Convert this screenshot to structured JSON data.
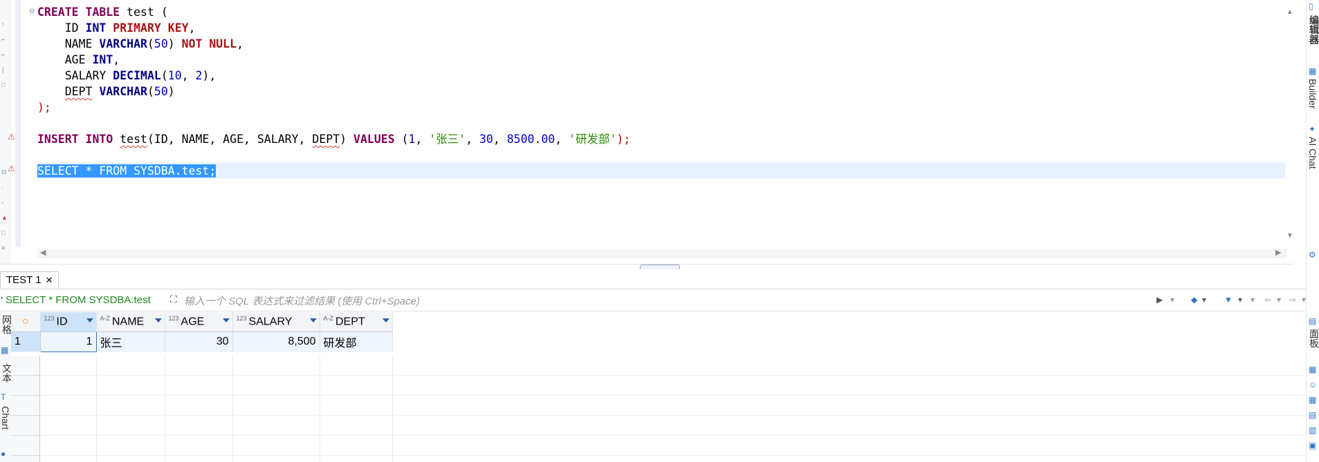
{
  "editor": {
    "lines": [
      {
        "parts": [
          {
            "t": "CREATE",
            "c": "kw-dark"
          },
          {
            "t": " "
          },
          {
            "t": "TABLE",
            "c": "kw-dark"
          },
          {
            "t": " test ("
          }
        ]
      },
      {
        "parts": [
          {
            "t": "    ID "
          },
          {
            "t": "INT",
            "c": "kw-navy"
          },
          {
            "t": " "
          },
          {
            "t": "PRIMARY KEY",
            "c": "kw-red"
          },
          {
            "t": ","
          }
        ]
      },
      {
        "parts": [
          {
            "t": "    NAME "
          },
          {
            "t": "VARCHAR",
            "c": "kw-navy"
          },
          {
            "t": "("
          },
          {
            "t": "50",
            "c": "num"
          },
          {
            "t": ") "
          },
          {
            "t": "NOT NULL",
            "c": "kw-red"
          },
          {
            "t": ","
          }
        ]
      },
      {
        "parts": [
          {
            "t": "    AGE "
          },
          {
            "t": "INT",
            "c": "kw-navy"
          },
          {
            "t": ","
          }
        ]
      },
      {
        "parts": [
          {
            "t": "    SALARY "
          },
          {
            "t": "DECIMAL",
            "c": "kw-navy"
          },
          {
            "t": "("
          },
          {
            "t": "10",
            "c": "num"
          },
          {
            "t": ", "
          },
          {
            "t": "2",
            "c": "num"
          },
          {
            "t": "),"
          }
        ]
      },
      {
        "parts": [
          {
            "t": "    "
          },
          {
            "t": "DEPT",
            "c": "squiggle"
          },
          {
            "t": " "
          },
          {
            "t": "VARCHAR",
            "c": "kw-navy"
          },
          {
            "t": "("
          },
          {
            "t": "50",
            "c": "num"
          },
          {
            "t": ")"
          }
        ]
      },
      {
        "parts": [
          {
            "t": ");",
            "c": "punct-red"
          }
        ]
      },
      {
        "parts": [
          {
            "t": ""
          }
        ]
      },
      {
        "parts": [
          {
            "t": "INSERT",
            "c": "kw-dark"
          },
          {
            "t": " "
          },
          {
            "t": "INTO",
            "c": "kw-dark"
          },
          {
            "t": " "
          },
          {
            "t": "test",
            "c": "squiggle"
          },
          {
            "t": "(ID, NAME, AGE, SALARY, "
          },
          {
            "t": "DEPT",
            "c": "squiggle"
          },
          {
            "t": ") "
          },
          {
            "t": "VALUES",
            "c": "kw-dark"
          },
          {
            "t": " ("
          },
          {
            "t": "1",
            "c": "num"
          },
          {
            "t": ", "
          },
          {
            "t": "'张三'",
            "c": "str"
          },
          {
            "t": ", "
          },
          {
            "t": "30",
            "c": "num"
          },
          {
            "t": ", "
          },
          {
            "t": "8500.00",
            "c": "num"
          },
          {
            "t": ", "
          },
          {
            "t": "'研发部'",
            "c": "str"
          },
          {
            "t": ");",
            "c": "punct-red"
          }
        ]
      },
      {
        "parts": [
          {
            "t": ""
          }
        ]
      },
      {
        "parts": [
          {
            "t": "SELECT * FROM SYSDBA.test;",
            "c": "sel"
          }
        ]
      }
    ]
  },
  "right_rail": {
    "tab_editor": "编辑器",
    "tab_builder": "Builder",
    "tab_ai_chat": "AI Chat",
    "tab_panels": "面板"
  },
  "result": {
    "tab_label": "TEST 1",
    "tab_close": "✕",
    "query_label": "SELECT * FROM SYSDBA.test",
    "filter_placeholder": "输入一个 SQL 表达式来过滤结果 (使用 Ctrl+Space)",
    "left_tabs": {
      "grid": "网格",
      "text": "文本",
      "chart": "Chart"
    },
    "columns": [
      {
        "type": "123",
        "name": "ID"
      },
      {
        "type": "A-Z",
        "name": "NAME"
      },
      {
        "type": "123",
        "name": "AGE"
      },
      {
        "type": "123",
        "name": "SALARY"
      },
      {
        "type": "A-Z",
        "name": "DEPT"
      }
    ],
    "rows": [
      {
        "num": "1",
        "cells": [
          "1",
          "张三",
          "30",
          "8,500",
          "研发部"
        ]
      }
    ]
  },
  "colors": {
    "selection": "#3399ff",
    "keyword": "#7f0055",
    "string": "#2a8a00",
    "number": "#0000c0"
  }
}
